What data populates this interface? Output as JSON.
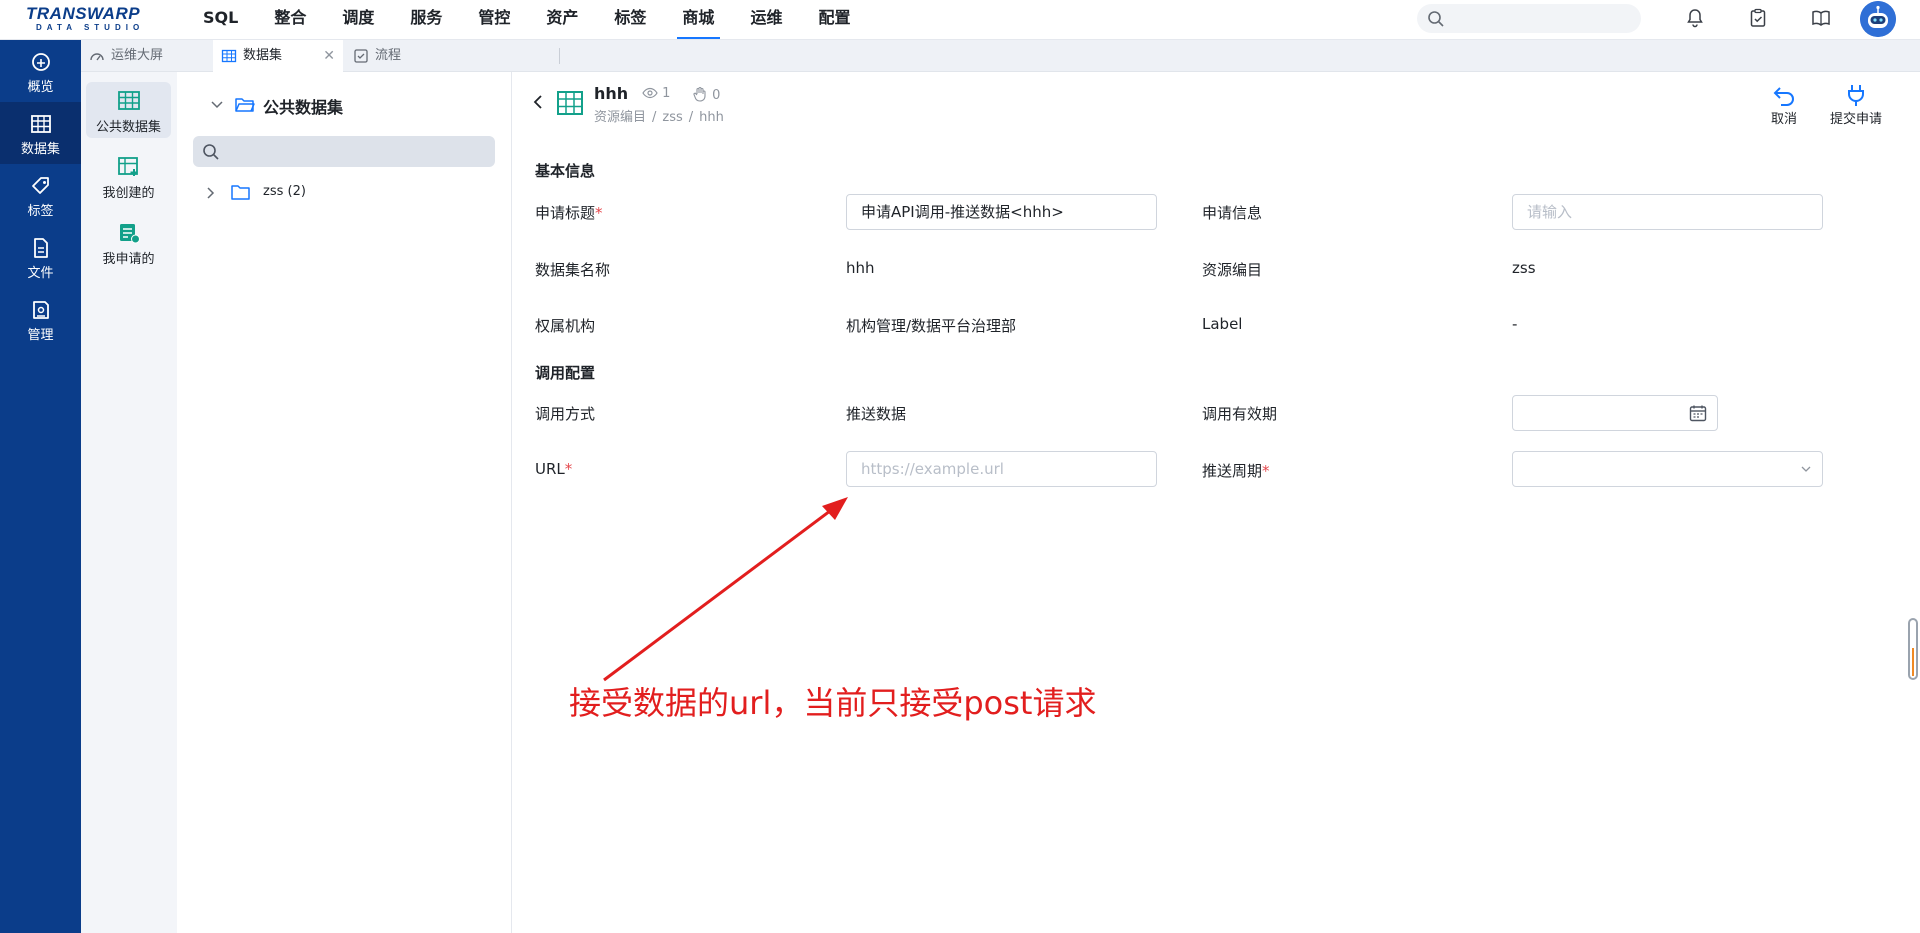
{
  "logo": {
    "line1": "TRANSWARP",
    "line2": "DATA STUDIO"
  },
  "nav": {
    "items": [
      "SQL",
      "整合",
      "调度",
      "服务",
      "管控",
      "资产",
      "标签",
      "商城",
      "运维",
      "配置"
    ],
    "active": "商城"
  },
  "header_icons": [
    "bell-icon",
    "clipboard-check-icon",
    "book-icon",
    "avatar"
  ],
  "rail": {
    "items": [
      {
        "label": "概览",
        "icon": "overview-icon"
      },
      {
        "label": "数据集",
        "icon": "table-icon"
      },
      {
        "label": "标签",
        "icon": "tag-icon"
      },
      {
        "label": "文件",
        "icon": "file-icon"
      },
      {
        "label": "管理",
        "icon": "manage-icon"
      }
    ],
    "active": "数据集"
  },
  "tabs": [
    {
      "label": "运维大屏",
      "icon": "gauge-icon"
    },
    {
      "label": "数据集",
      "icon": "table-icon",
      "active": true
    },
    {
      "label": "流程",
      "icon": "checklist-icon"
    }
  ],
  "subnav": {
    "items": [
      "公共数据集",
      "我创建的",
      "我申请的"
    ],
    "active": "公共数据集"
  },
  "tree": {
    "root": "公共数据集",
    "search_placeholder": "",
    "nodes": [
      {
        "label": "zss (2)"
      }
    ]
  },
  "detail": {
    "title": "hhh",
    "views": "1",
    "applies": "0",
    "breadcrumb": [
      "资源编目",
      "/",
      "zss",
      "/",
      "hhh"
    ],
    "actions": {
      "cancel": "取消",
      "submit": "提交申请"
    }
  },
  "form": {
    "section_basic": "基本信息",
    "apply_title_label": "申请标题",
    "apply_title_value": "申请API调用-推送数据<hhh>",
    "apply_info_label": "申请信息",
    "apply_info_placeholder": "请输入",
    "dataset_name_label": "数据集名称",
    "dataset_name_value": "hhh",
    "catalog_label": "资源编目",
    "catalog_value": "zss",
    "org_label": "权属机构",
    "org_value": "机构管理/数据平台治理部",
    "label_label": "Label",
    "label_value": "-",
    "section_call": "调用配置",
    "call_mode_label": "调用方式",
    "call_mode_value": "推送数据",
    "validity_label": "调用有效期",
    "url_label": "URL",
    "url_placeholder": "https://example.url",
    "push_cycle_label": "推送周期",
    "required_mark": "*"
  },
  "annotation": {
    "text": "接受数据的url，当前只接受post请求",
    "color": "#e21e1e"
  },
  "colors": {
    "brand": "#0b3d8a",
    "accent": "#1677ff",
    "teal": "#12a08a",
    "required": "#e5484d"
  }
}
